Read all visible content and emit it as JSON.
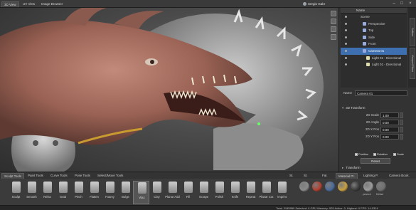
{
  "topbar": {
    "tabs": [
      {
        "label": "3D View",
        "active": true
      },
      {
        "label": "UV View",
        "active": false
      },
      {
        "label": "Image Browser",
        "active": false
      }
    ],
    "user_name": "Sergio Gabr",
    "window_controls": [
      "minimize-icon",
      "maximize-icon",
      "close-icon"
    ]
  },
  "viewport": {
    "description_icons": [
      "view-icon",
      "camera-icon",
      "grid-icon",
      "light-icon"
    ]
  },
  "outliner": {
    "header": "Name",
    "rows": [
      {
        "label": "Scene",
        "indent": 0,
        "selected": false
      },
      {
        "label": "Perspective",
        "indent": 1,
        "selected": false
      },
      {
        "label": "Top",
        "indent": 1,
        "selected": false
      },
      {
        "label": "Side",
        "indent": 1,
        "selected": false
      },
      {
        "label": "Front",
        "indent": 1,
        "selected": false
      },
      {
        "label": "Camera 01",
        "indent": 1,
        "selected": true
      },
      {
        "label": "Light 01 - Directional",
        "indent": 2,
        "selected": false
      },
      {
        "label": "Light 01 - Directional",
        "indent": 2,
        "selected": false
      }
    ],
    "side_tabs": [
      "Outliner",
      "Viewport Filters"
    ]
  },
  "properties": {
    "name_label": "Name",
    "name_value": "Camera 01",
    "section_3d_transform": "3D Transform",
    "fields": [
      {
        "label": "2D Scale",
        "value": "1.00"
      },
      {
        "label": "2D Angle",
        "value": "0.00"
      },
      {
        "label": "2D X Pos",
        "value": "0.00"
      },
      {
        "label": "2D Y Pos",
        "value": "0.00"
      }
    ],
    "checks": [
      "Position",
      "Rotation",
      "Scale"
    ],
    "reset_label": "Reset",
    "section_transform": "Transform"
  },
  "bottom": {
    "tabs": [
      {
        "label": "Sculpt Tools",
        "active": true
      },
      {
        "label": "Paint Tools",
        "active": false
      },
      {
        "label": "Curve Tools",
        "active": false
      },
      {
        "label": "Pose Tools",
        "active": false
      },
      {
        "label": "Select/Move Tools",
        "active": false
      }
    ],
    "right_tabs": [
      {
        "label": "St.",
        "active": false
      },
      {
        "label": "St.",
        "active": false
      },
      {
        "label": "Fal.",
        "active": false
      },
      {
        "label": "Material Pr.",
        "active": true
      },
      {
        "label": "Lighting P.",
        "active": false
      },
      {
        "label": "Camera Book.",
        "active": false
      }
    ],
    "tools": [
      "Sculpt",
      "Smooth",
      "Relax",
      "Grab",
      "Pinch",
      "Flatten",
      "Foamy",
      "Bulge",
      "Wax",
      "Clay",
      "Planar Add",
      "Fill",
      "Scrape",
      "Polish",
      "Knife",
      "Repeat",
      "Planar Cut",
      "Imprint"
    ],
    "active_tool": "Wax",
    "materials": [
      {
        "color": "#8a8a8a",
        "label": ""
      },
      {
        "color": "#b04030",
        "label": ""
      },
      {
        "color": "#4a6a9a",
        "label": ""
      },
      {
        "color": "#c8a040",
        "label": ""
      },
      {
        "color": "#3a3a3a",
        "label": ""
      },
      {
        "color": "#9a9a9a",
        "label": "pewsch"
      },
      {
        "color": "#707070",
        "label": "Defaul"
      }
    ]
  },
  "status": {
    "text": "Total: 3185989  Selected: 0  GPU Memory: 925  Active: 0, Highest: 0  FPS: 14.0314"
  }
}
